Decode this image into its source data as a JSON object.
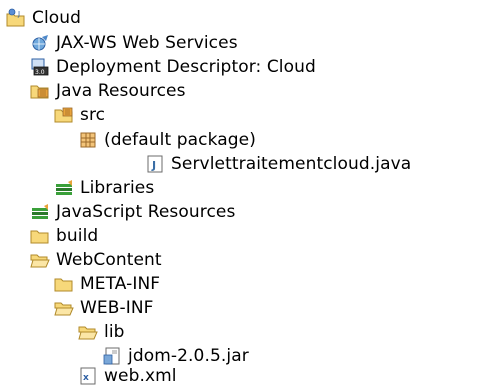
{
  "tree": {
    "root": {
      "label": "Cloud",
      "icon": "project-icon"
    },
    "jaxws": {
      "label": "JAX-WS Web Services",
      "icon": "web-services-icon"
    },
    "descriptor": {
      "label": "Deployment Descriptor: Cloud",
      "icon": "deployment-descriptor-icon"
    },
    "java_resources": {
      "label": "Java Resources",
      "icon": "java-resources-icon"
    },
    "src": {
      "label": "src",
      "icon": "source-folder-icon"
    },
    "default_package": {
      "label": "(default package)",
      "icon": "package-icon"
    },
    "java_file": {
      "label": "Servlettraitementcloud.java",
      "icon": "java-file-icon"
    },
    "libraries": {
      "label": "Libraries",
      "icon": "libraries-icon"
    },
    "js_resources": {
      "label": "JavaScript Resources",
      "icon": "libraries-icon"
    },
    "build": {
      "label": "build",
      "icon": "folder-icon"
    },
    "webcontent": {
      "label": "WebContent",
      "icon": "folder-open-icon"
    },
    "metainf": {
      "label": "META-INF",
      "icon": "folder-icon"
    },
    "webinf": {
      "label": "WEB-INF",
      "icon": "folder-open-icon"
    },
    "lib": {
      "label": "lib",
      "icon": "folder-open-icon"
    },
    "jar": {
      "label": "jdom-2.0.5.jar",
      "icon": "jar-icon"
    },
    "webxml": {
      "label": "web.xml",
      "icon": "xml-file-icon"
    }
  },
  "colors": {
    "folder_fill": "#f7d87a",
    "folder_stroke": "#b08a2a",
    "package_brown": "#9b6a2b",
    "java_blue": "#3a6ea5",
    "library_green": "#3aa03a"
  }
}
